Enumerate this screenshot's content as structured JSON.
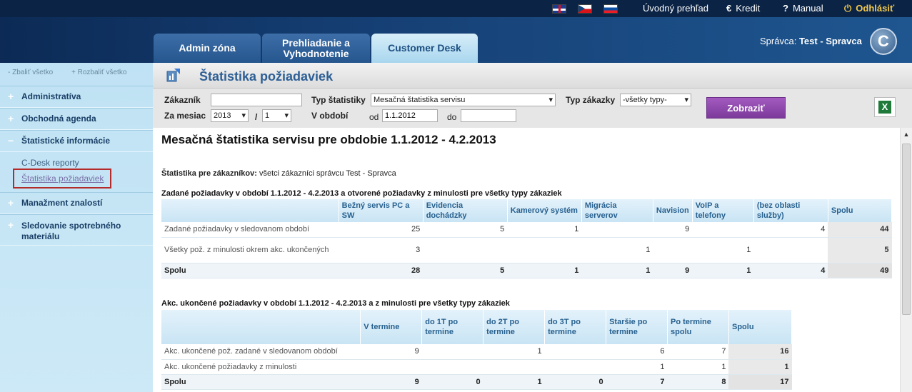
{
  "topbar": {
    "overview": "Úvodný prehľad",
    "credit": "Kredit",
    "manual": "Manual",
    "logout": "Odhlásiť"
  },
  "tabs": {
    "admin": "Admin zóna",
    "browse_line1": "Prehliadanie a",
    "browse_line2": "Vyhodnotenie",
    "customer": "Customer Desk"
  },
  "admin_label": "Správca:",
  "admin_name": "Test - Spravca",
  "logo_letter": "C",
  "sidebar": {
    "collapse_all": "- Zbaliť všetko",
    "expand_all": "+ Rozbaliť všetko",
    "items": {
      "administrativa": "Administratíva",
      "obchodna": "Obchodná agenda",
      "statisticke": "Štatistické informácie",
      "cdesk": "C-Desk reporty",
      "statistika": "Štatistika požiadaviek",
      "manazment": "Manažment znalostí",
      "sledovanie1": "Sledovanie spotrebného",
      "sledovanie2": "materiálu"
    }
  },
  "page_title": "Štatistika požiadaviek",
  "filters": {
    "customer_label": "Zákazník",
    "customer_value": "",
    "type_label": "Typ štatistiky",
    "type_value": "Mesačná štatistika servisu",
    "order_type_label": "Typ zákazky",
    "order_type_value": "-všetky typy-",
    "month_label": "Za mesiac",
    "year_value": "2013",
    "slash": "/",
    "month_value": "1",
    "period_label": "V období",
    "from_label": "od",
    "from_value": "1.1.2012",
    "to_label": "do",
    "to_value": "",
    "show_button": "Zobraziť",
    "excel_icon": "X"
  },
  "report": {
    "title": "Mesačná štatistika servisu pre obdobie 1.1.2012 - 4.2.2013",
    "customers_label": "Štatistika pre zákazníkov:",
    "customers_value": "všetci zákazníci správcu Test - Spravca",
    "table1": {
      "title": "Zadané požiadavky v období 1.1.2012 - 4.2.2013 a otvorené požiadavky z minulosti pre všetky typy zákaziek",
      "headers": [
        "Bežný servis PC a SW",
        "Evidencia dochádzky",
        "Kamerový systém",
        "Migrácia serverov",
        "Navision",
        "VoIP a telefony",
        "(bez oblasti služby)",
        "Spolu"
      ],
      "rows": [
        {
          "label": "Zadané požiadavky v sledovanom období",
          "cells": [
            "25",
            "5",
            "1",
            "",
            "9",
            "",
            "4",
            "44"
          ]
        },
        {
          "label": "Všetky pož. z minulosti okrem akc. ukončených",
          "cells": [
            "3",
            "",
            "",
            "1",
            "",
            "1",
            "",
            "5"
          ]
        },
        {
          "label": "Spolu",
          "cells": [
            "28",
            "5",
            "1",
            "1",
            "9",
            "1",
            "4",
            "49"
          ]
        }
      ]
    },
    "table2": {
      "title": "Akc. ukončené požiadavky v období 1.1.2012 - 4.2.2013 a z minulosti pre všetky typy zákaziek",
      "headers": [
        "V termine",
        "do 1T po termine",
        "do 2T po termine",
        "do 3T po termine",
        "Staršie po termine",
        "Po termine spolu",
        "Spolu"
      ],
      "rows": [
        {
          "label": "Akc. ukončené pož. zadané v sledovanom období",
          "cells": [
            "9",
            "",
            "1",
            "",
            "6",
            "7",
            "16"
          ]
        },
        {
          "label": "Akc. ukončené požiadavky z minulosti",
          "cells": [
            "",
            "",
            "",
            "",
            "1",
            "1",
            "1"
          ]
        },
        {
          "label": "Spolu",
          "cells": [
            "9",
            "0",
            "1",
            "0",
            "7",
            "8",
            "17"
          ]
        }
      ]
    }
  }
}
